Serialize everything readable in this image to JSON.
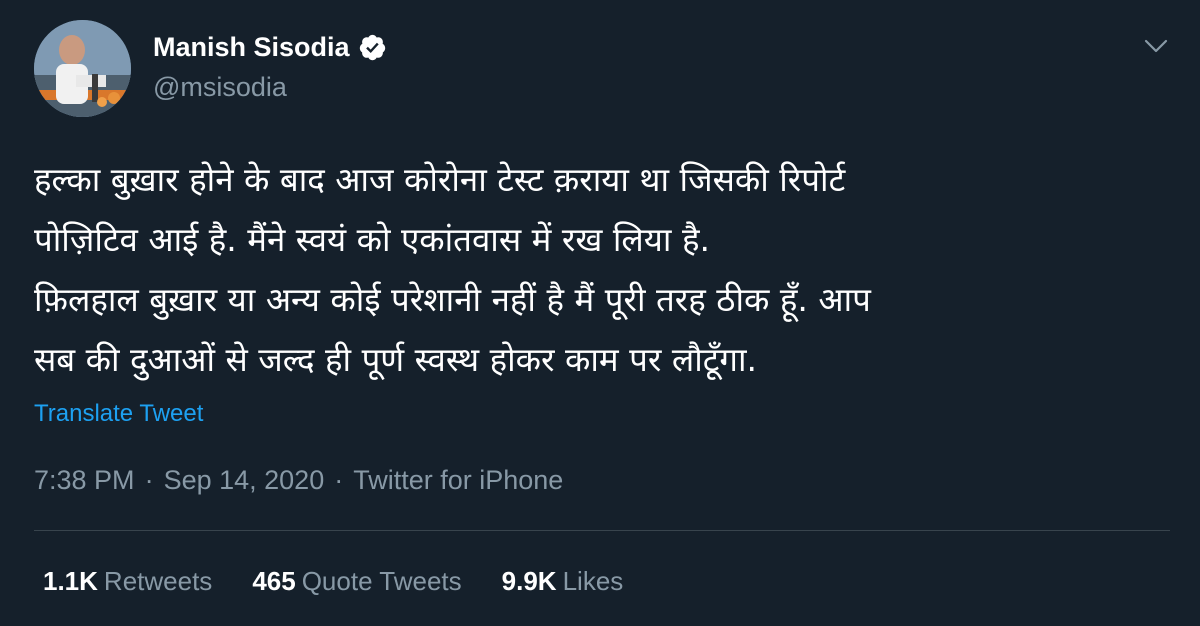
{
  "author": {
    "name": "Manish Sisodia",
    "handle": "@msisodia",
    "verified": true,
    "avatar_icon": "profile-photo"
  },
  "tweet": {
    "lines": [
      "हल्का बुख़ार होने के बाद आज कोरोना टेस्ट क़राया था जिसकी रिपोर्ट",
      "पोज़िटिव आई है. मैंने स्वयं को एकांतवास में रख लिया है.",
      "फ़िलहाल बुख़ार या अन्य कोई परेशानी नहीं है मैं पूरी तरह ठीक हूँ. आप",
      "सब की दुआओं से जल्द ही पूर्ण स्वस्थ होकर काम पर लौटूँगा."
    ],
    "translate_label": "Translate Tweet"
  },
  "meta": {
    "time": "7:38 PM",
    "date": "Sep 14, 2020",
    "separator": "·",
    "source": "Twitter for iPhone"
  },
  "stats": {
    "retweets": {
      "count": "1.1K",
      "label": "Retweets"
    },
    "quotes": {
      "count": "465",
      "label": "Quote Tweets"
    },
    "likes": {
      "count": "9.9K",
      "label": "Likes"
    }
  },
  "colors": {
    "background": "#15202b",
    "text_primary": "#ffffff",
    "text_secondary": "#8899a6",
    "link": "#1da1f2",
    "divider": "#38444d"
  }
}
